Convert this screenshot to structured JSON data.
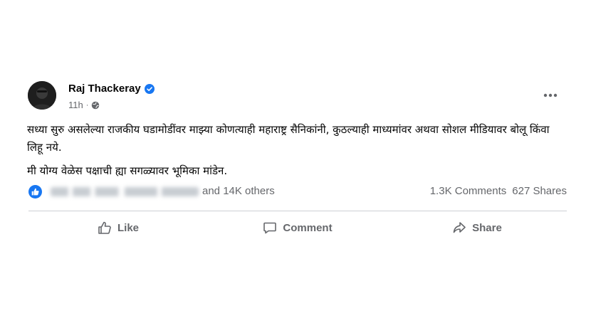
{
  "post": {
    "author": {
      "name": "Raj Thackeray",
      "verified": true
    },
    "meta": {
      "time": "11h",
      "separator": "·",
      "privacy_icon": "globe-icon"
    },
    "menu_icon": "more-dots-icon",
    "body": {
      "paragraphs": [
        "सध्या सुरु असलेल्या राजकीय घडामोडींवर माझ्या कोणत्याही महाराष्ट्र सैनिकांनी, कुठल्याही माध्यमांवर अथवा सोशल मीडियावर बोलू किंवा लिहू नये.",
        "मी योग्य वेळेस पक्षाची ह्या सगळ्यावर भूमिका मांडेन."
      ]
    },
    "stats": {
      "reaction_icon": "like-reaction-icon",
      "reactors_suffix": "and 14K others",
      "comments": "1.3K Comments",
      "shares": "627 Shares"
    },
    "actions": {
      "like": "Like",
      "comment": "Comment",
      "share": "Share"
    }
  },
  "colors": {
    "accent": "#1877f2",
    "secondary_text": "#65676b",
    "primary_text": "#050505",
    "divider": "#ced0d4"
  }
}
